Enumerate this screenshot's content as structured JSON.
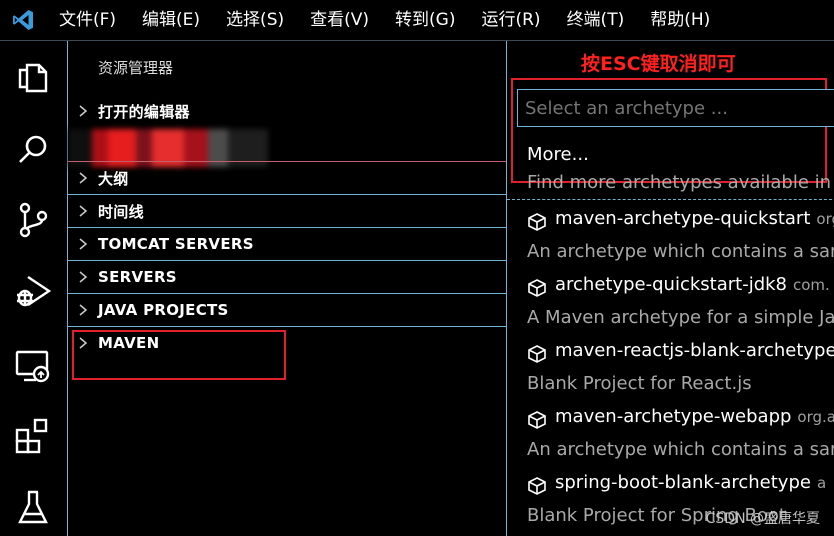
{
  "menu": {
    "items": [
      "文件(F)",
      "编辑(E)",
      "选择(S)",
      "查看(V)",
      "转到(G)",
      "运行(R)",
      "终端(T)",
      "帮助(H)"
    ]
  },
  "activity_bar": {
    "icons": [
      "explorer-icon",
      "search-icon",
      "source-control-icon",
      "run-debug-icon",
      "remote-explorer-icon",
      "extensions-icon",
      "testing-icon"
    ]
  },
  "sidebar": {
    "title": "资源管理器",
    "sections": [
      {
        "label": "打开的编辑器"
      },
      {
        "label": "大纲"
      },
      {
        "label": "时间线"
      },
      {
        "label": "TOMCAT SERVERS"
      },
      {
        "label": "SERVERS"
      },
      {
        "label": "JAVA PROJECTS"
      },
      {
        "label": "MAVEN"
      }
    ]
  },
  "quick_pick": {
    "annotation": "按ESC键取消即可",
    "placeholder": "Select an archetype ...",
    "more_title": "More...",
    "more_desc": "Find more archetypes available in re",
    "items": [
      {
        "name": "maven-archetype-quickstart",
        "group": "org",
        "desc": "An archetype which contains a samp"
      },
      {
        "name": "archetype-quickstart-jdk8",
        "group": "com.",
        "desc": "A Maven archetype for a simple Jav"
      },
      {
        "name": "maven-reactjs-blank-archetype",
        "group": "",
        "desc": "Blank Project for React.js"
      },
      {
        "name": "maven-archetype-webapp",
        "group": "org.a",
        "desc": "An archetype which contains a samp"
      },
      {
        "name": "spring-boot-blank-archetype",
        "group": "a",
        "desc": "Blank Project for Spring Boot"
      }
    ]
  },
  "watermark": "CSDN @盛唐华夏",
  "colors": {
    "accent": "#6fb5d6",
    "annotation": "#e0202a",
    "vscode_blue": "#3a9bdc"
  }
}
